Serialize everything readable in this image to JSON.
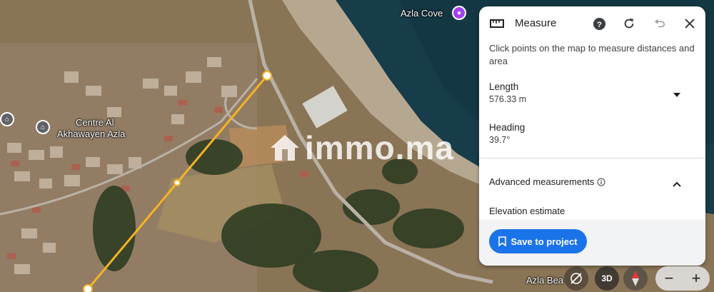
{
  "map": {
    "labels": {
      "azla_cove": "Azla Cove",
      "centre_line1": "Centre Al",
      "centre_line2": "Akhawayen Azla",
      "azla_beach": "Azla Bea"
    },
    "watermark": "immo.ma",
    "measure_line_color": "#f5b324"
  },
  "panel": {
    "title": "Measure",
    "description": "Click points on the map to measure distances and area",
    "length_label": "Length",
    "length_value": "576.33 m",
    "heading_label": "Heading",
    "heading_value": "39.7°",
    "advanced_label": "Advanced measurements",
    "elevation_label": "Elevation estimate",
    "save_button": "Save to project"
  },
  "controls": {
    "threed_label": "3D",
    "zoom_out": "−",
    "zoom_in": "+"
  },
  "colors": {
    "accent": "#1a73e8",
    "pin_purple": "#a142f4",
    "pin_grey": "#5f6368"
  }
}
